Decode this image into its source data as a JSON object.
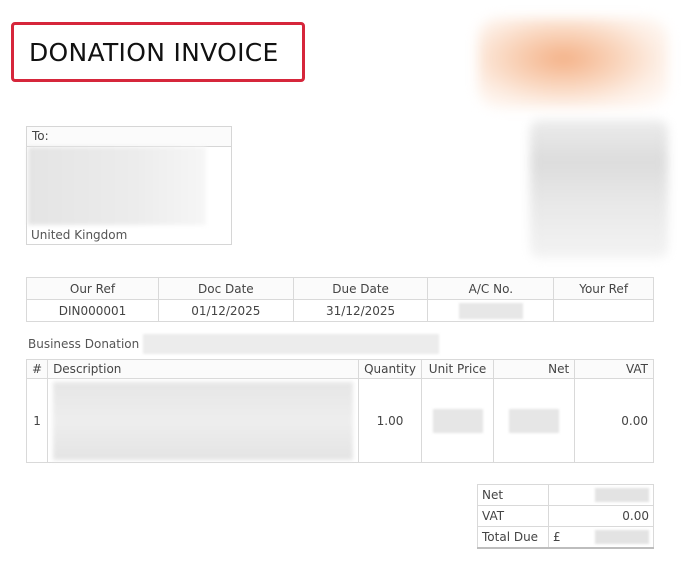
{
  "header": {
    "title": "DONATION INVOICE"
  },
  "to": {
    "label": "To:",
    "country": "United Kingdom"
  },
  "references": {
    "headers": [
      "Our Ref",
      "Doc Date",
      "Due Date",
      "A/C No.",
      "Your Ref"
    ],
    "values": [
      "DIN000001",
      "01/12/2025",
      "31/12/2025",
      "",
      ""
    ]
  },
  "business": {
    "label": "Business Donation"
  },
  "items": {
    "headers": [
      "#",
      "Description",
      "Quantity",
      "Unit Price",
      "Net",
      "VAT"
    ],
    "rows": [
      {
        "num": "1",
        "description": "",
        "quantity": "1.00",
        "unit_price": "",
        "net": "",
        "vat": "0.00"
      }
    ]
  },
  "totals": {
    "net_label": "Net",
    "vat_label": "VAT",
    "vat_value": "0.00",
    "total_label": "Total Due",
    "currency": "£"
  }
}
